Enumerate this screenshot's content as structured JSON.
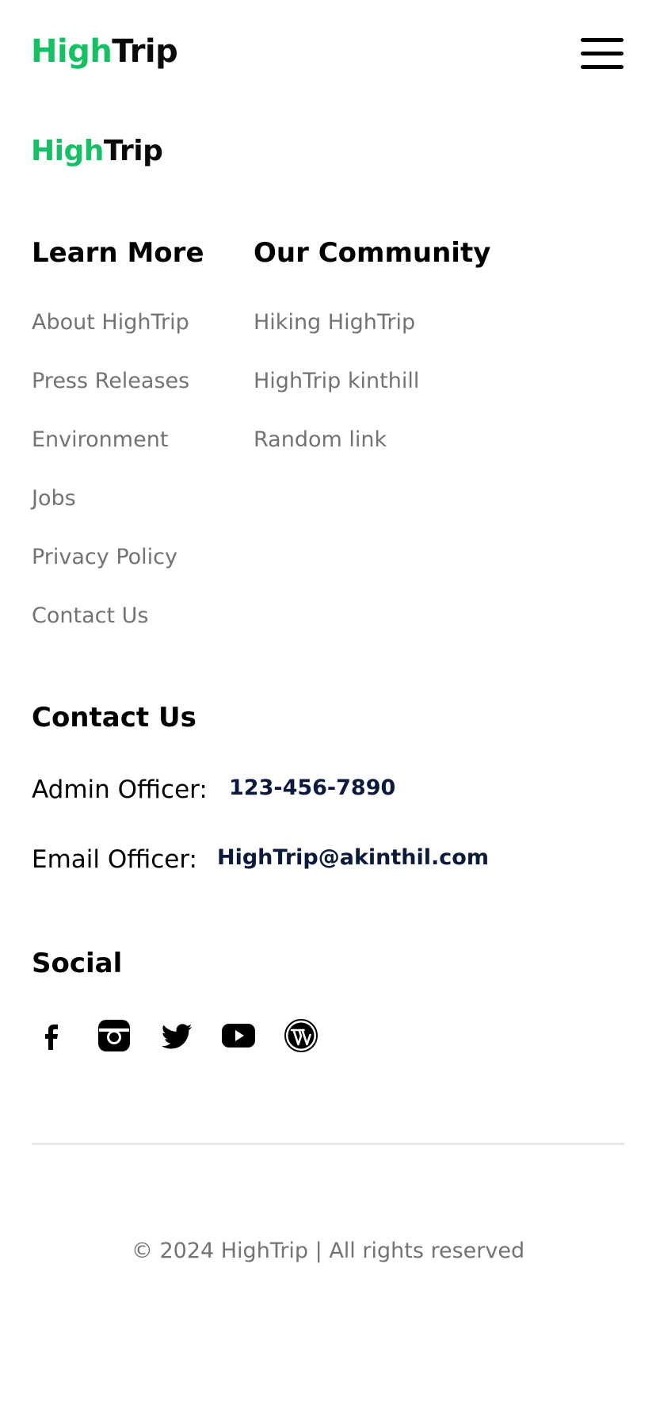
{
  "header": {
    "logo_high": "High",
    "logo_trip": "Trip"
  },
  "footer_logo": {
    "high": "High",
    "trip": "Trip"
  },
  "learn_more": {
    "title": "Learn More",
    "links": [
      "About HighTrip",
      "Press Releases",
      "Environment",
      "Jobs",
      "Privacy Policy",
      "Contact Us"
    ]
  },
  "community": {
    "title": "Our Community",
    "links": [
      "Hiking HighTrip",
      "HighTrip kinthill",
      "Random link"
    ]
  },
  "contact": {
    "title": "Contact Us",
    "admin_label": "Admin Officer:",
    "admin_value": "123-456-7890",
    "email_label": "Email Officer:",
    "email_value": "HighTrip@akinthil.com"
  },
  "social": {
    "title": "Social",
    "icons": [
      "facebook-icon",
      "instagram-icon",
      "twitter-icon",
      "youtube-icon",
      "wordpress-icon"
    ]
  },
  "copyright": "© 2024 HighTrip | All rights reserved",
  "colors": {
    "brand_green": "#17c064",
    "link_gray": "#737373",
    "contact_navy": "#0c1a3d",
    "divider": "#e8e8e8"
  }
}
